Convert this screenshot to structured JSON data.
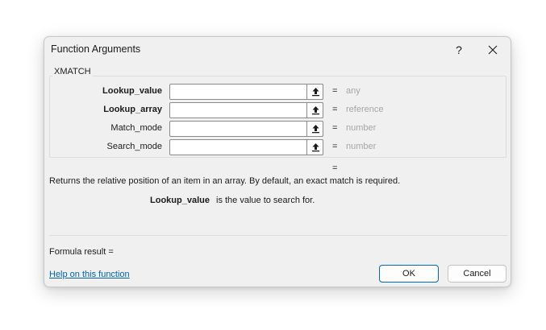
{
  "dialog": {
    "title": "Function Arguments",
    "help_button": "?",
    "close_button_icon": "close-icon"
  },
  "function": {
    "name": "XMATCH",
    "arguments": [
      {
        "label": "Lookup_value",
        "bold": true,
        "value": "",
        "hint": "any"
      },
      {
        "label": "Lookup_array",
        "bold": true,
        "value": "",
        "hint": "reference"
      },
      {
        "label": "Match_mode",
        "bold": false,
        "value": "",
        "hint": "number"
      },
      {
        "label": "Search_mode",
        "bold": false,
        "value": "",
        "hint": "number"
      }
    ],
    "equals_sign": "=",
    "result_equals": "=",
    "description": "Returns the relative position of an item in an array. By default, an exact match is required.",
    "current_argument_name": "Lookup_value",
    "current_argument_help": "is the value to search for."
  },
  "footer": {
    "formula_result": "Formula result =",
    "help_link": "Help on this function",
    "ok_label": "OK",
    "cancel_label": "Cancel"
  },
  "colors": {
    "dialog_bg": "#f0f0f0",
    "accent": "#0067c0",
    "link": "#0063b1",
    "hint": "#a6a6a6"
  }
}
